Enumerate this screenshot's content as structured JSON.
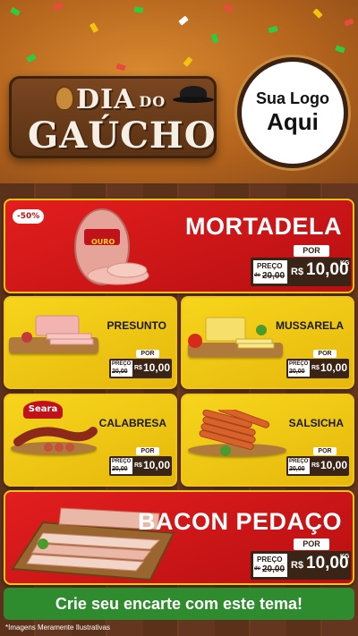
{
  "header": {
    "title_top": "DIA",
    "title_do": "DO",
    "title_main": "GAÚCHO",
    "logo_line1": "Sua Logo",
    "logo_line2": "Aqui"
  },
  "products": {
    "mortadela": {
      "name": "MORTADELA",
      "discount": "-50%",
      "brand": "OURO",
      "por": "POR",
      "preco": "PREÇO",
      "old": "20,00",
      "old_prefix": "de",
      "currency": "R$",
      "price": "10,00",
      "unit": "KG"
    },
    "presunto": {
      "name": "PRESUNTO",
      "por": "POR",
      "preco": "PREÇO",
      "old": "20,00",
      "old_prefix": "de",
      "currency": "R$",
      "price": "10,00",
      "unit": "KG"
    },
    "mussarela": {
      "name": "MUSSARELA",
      "por": "POR",
      "preco": "PREÇO",
      "old": "20,00",
      "old_prefix": "de",
      "currency": "R$",
      "price": "10,00",
      "unit": "KG"
    },
    "calabresa": {
      "name": "CALABRESA",
      "brand": "Seara",
      "por": "POR",
      "preco": "PREÇO",
      "old": "20,00",
      "old_prefix": "de",
      "currency": "R$",
      "price": "10,00",
      "unit": "KG"
    },
    "salsicha": {
      "name": "SALSICHA",
      "por": "POR",
      "preco": "PREÇO",
      "old": "20,00",
      "old_prefix": "de",
      "currency": "R$",
      "price": "10,00",
      "unit": "KG"
    },
    "bacon": {
      "name": "BACON PEDAÇO",
      "por": "POR",
      "preco": "PREÇO",
      "old": "20,00",
      "old_prefix": "de",
      "currency": "R$",
      "price": "10,00",
      "unit": "KG"
    }
  },
  "cta": "Crie seu encarte com este tema!",
  "note": "*Imagens Meramente Ilustrativas",
  "colors": {
    "red": "#e31e1e",
    "yellow": "#f7d51c",
    "wood": "#5c3119",
    "green": "#2e8b2e"
  }
}
